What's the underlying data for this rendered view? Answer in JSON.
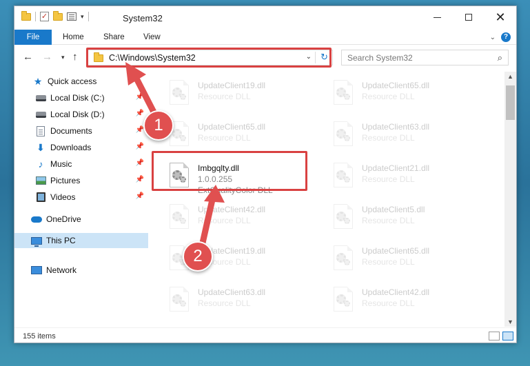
{
  "window": {
    "title": "System32"
  },
  "ribbon": {
    "tabs": [
      "File",
      "Home",
      "Share",
      "View"
    ]
  },
  "address": {
    "path": "C:\\Windows\\System32"
  },
  "search": {
    "placeholder": "Search System32"
  },
  "sidebar": {
    "items": [
      {
        "label": "Quick access"
      },
      {
        "label": "Local Disk (C:)"
      },
      {
        "label": "Local Disk (D:)"
      },
      {
        "label": "Documents"
      },
      {
        "label": "Downloads"
      },
      {
        "label": "Music"
      },
      {
        "label": "Pictures"
      },
      {
        "label": "Videos"
      },
      {
        "label": "OneDrive"
      },
      {
        "label": "This PC"
      },
      {
        "label": "Network"
      }
    ]
  },
  "files": {
    "left": [
      {
        "name": "UpdateClient19.dll",
        "desc": "Resource DLL"
      },
      {
        "name": "UpdateClient65.dll",
        "desc": "Resource DLL"
      },
      {
        "name": "Imbgqlty.dll",
        "desc": "1.0.0.255",
        "extra": "ExtQualityColor DLL"
      },
      {
        "name": "UpdateClient42.dll",
        "desc": "Resource DLL"
      },
      {
        "name": "UpdateClient19.dll",
        "desc": "Resource DLL"
      },
      {
        "name": "UpdateClient63.dll",
        "desc": "Resource DLL"
      }
    ],
    "right": [
      {
        "name": "UpdateClient65.dll",
        "desc": "Resource DLL"
      },
      {
        "name": "UpdateClient63.dll",
        "desc": "Resource DLL"
      },
      {
        "name": "UpdateClient21.dll",
        "desc": "Resource DLL"
      },
      {
        "name": "UpdateClient5.dll",
        "desc": "Resource DLL"
      },
      {
        "name": "UpdateClient65.dll",
        "desc": "Resource DLL"
      },
      {
        "name": "UpdateClient42.dll",
        "desc": "Resource DLL"
      }
    ]
  },
  "status": {
    "item_count": "155 items"
  },
  "annotations": {
    "step1": "1",
    "step2": "2"
  },
  "colors": {
    "accent": "#1979ca",
    "highlight": "#d94141",
    "badge": "#e05050"
  }
}
